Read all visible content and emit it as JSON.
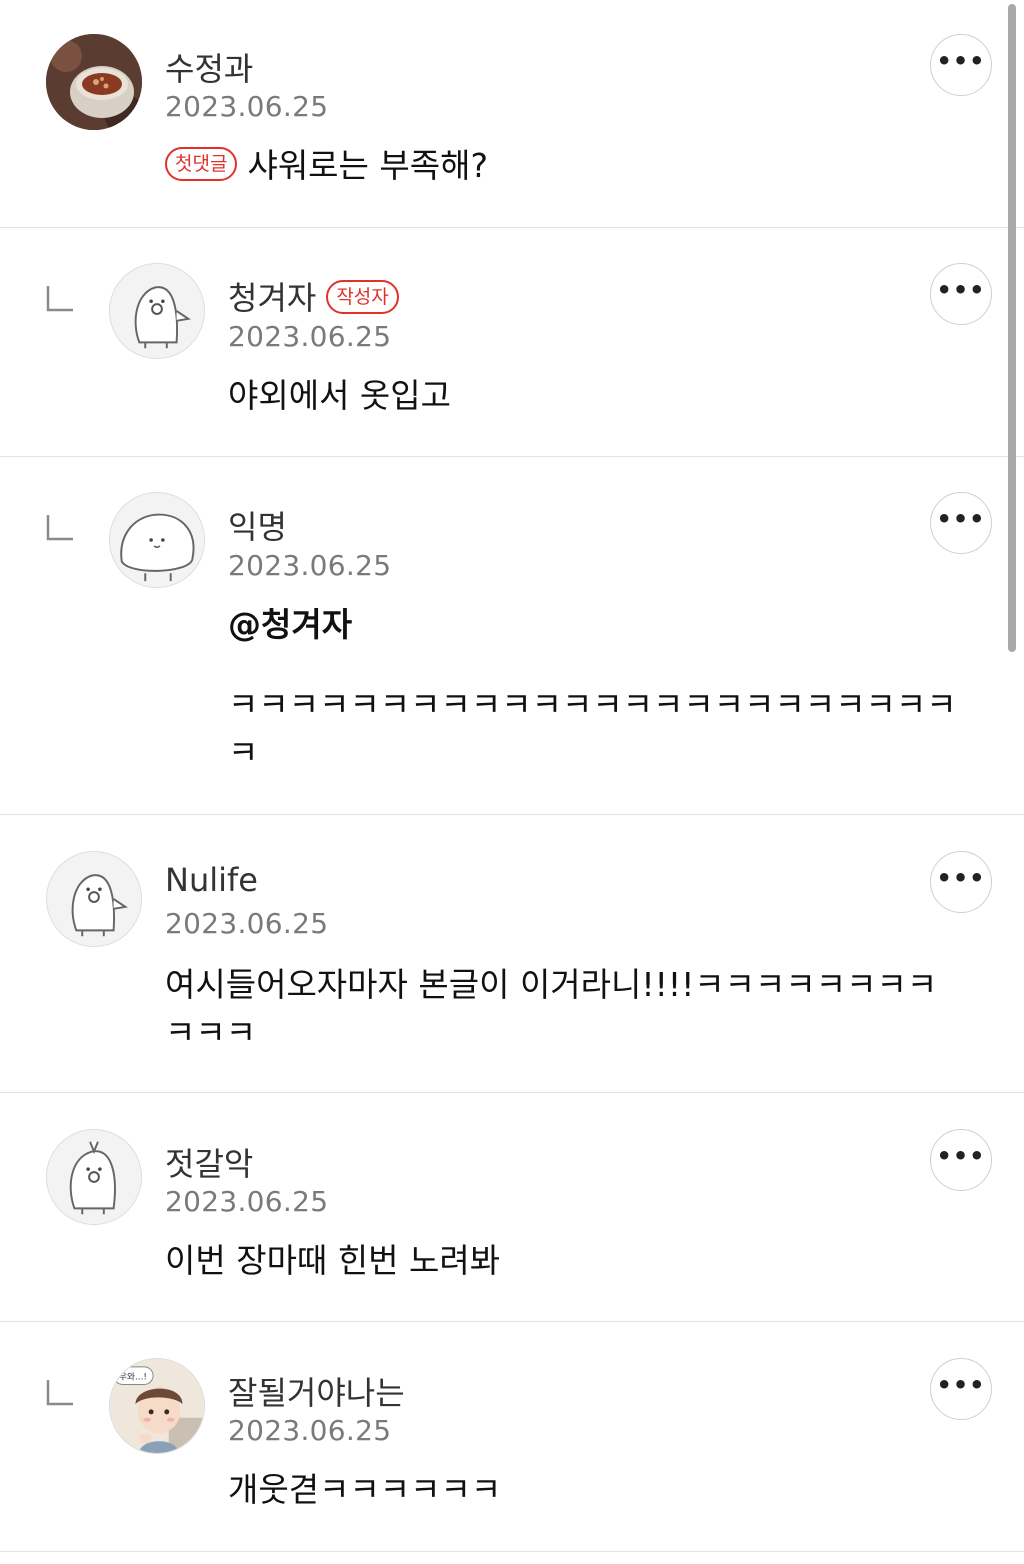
{
  "ui": {
    "more_glyph": "•••",
    "accent_color": "#e0322b",
    "scrollbar_color": "#a9a9a9"
  },
  "comments": [
    {
      "author": "수정과",
      "date": "2023.06.25",
      "badge": "첫댓글",
      "text": "샤워로는 부족해?",
      "is_reply": false,
      "avatar": "soup-bowl-photo"
    },
    {
      "author": "청겨자",
      "author_badge": "작성자",
      "date": "2023.06.25",
      "text": "야외에서 옷입고",
      "is_reply": true,
      "avatar": "pig-ghost"
    },
    {
      "author": "익명",
      "date": "2023.06.25",
      "mention": "@청겨자",
      "text": "ㅋㅋㅋㅋㅋㅋㅋㅋㅋㅋㅋㅋㅋㅋㅋㅋㅋㅋㅋㅋㅋㅋㅋㅋㅋ",
      "is_reply": true,
      "avatar": "seal-blob"
    },
    {
      "author": "Nulife",
      "date": "2023.06.25",
      "text": "여시들어오자마자 본글이 이거라니!!!!ㅋㅋㅋㅋㅋㅋㅋㅋㅋㅋㅋ",
      "is_reply": false,
      "avatar": "pig-ghost"
    },
    {
      "author": "젓갈악",
      "date": "2023.06.25",
      "text": "이번 장마때 힌번 노려봐",
      "is_reply": false,
      "avatar": "pig-ghost"
    },
    {
      "author": "잘될거야나는",
      "date": "2023.06.25",
      "text": "개웃겯ㅋㅋㅋㅋㅋㅋ",
      "is_reply": true,
      "avatar": "cartoon-boy",
      "avatar_caption": "우와...!"
    }
  ]
}
